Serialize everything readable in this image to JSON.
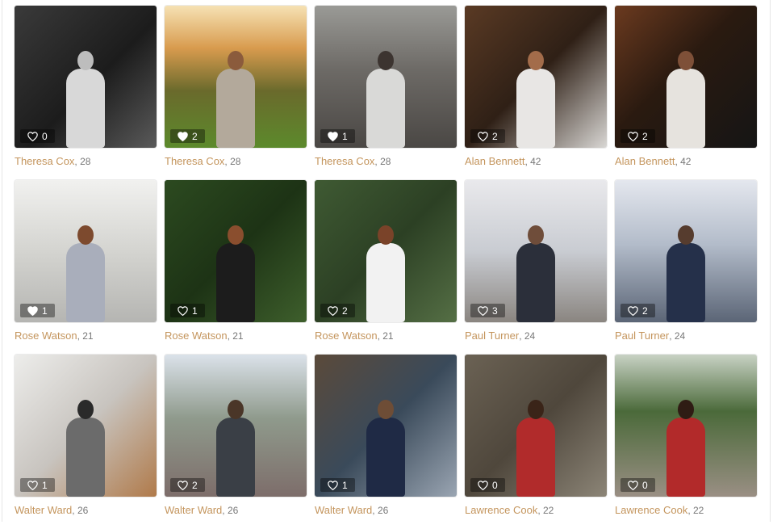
{
  "gallery": {
    "items": [
      {
        "name": "Theresa Cox",
        "age": "28",
        "likes": "0",
        "liked": false,
        "bg": "linear-gradient(135deg,#3a3a3a 0%,#1c1c1c 55%,#5a5a5a 100%)",
        "fig": "#d8d8d8",
        "head": "#bdbdbd"
      },
      {
        "name": "Theresa Cox",
        "age": "28",
        "likes": "2",
        "liked": true,
        "bg": "linear-gradient(180deg,#f6e2b4 0%,#d89b4e 30%,#6a6a2c 60%,#5c8a2c 100%)",
        "fig": "#b3a99b",
        "head": "#8b5b3c"
      },
      {
        "name": "Theresa Cox",
        "age": "28",
        "likes": "1",
        "liked": true,
        "bg": "linear-gradient(180deg,#9a9a96 0%,#6d6a66 45%,#4a4744 100%)",
        "fig": "#d9d9d7",
        "head": "#3c3430"
      },
      {
        "name": "Alan Bennett",
        "age": "42",
        "likes": "2",
        "liked": false,
        "bg": "linear-gradient(135deg,#5a3a24 0%,#2f2016 50%,#d9d7d4 100%)",
        "fig": "#e8e6e4",
        "head": "#a36c4a"
      },
      {
        "name": "Alan Bennett",
        "age": "42",
        "likes": "2",
        "liked": false,
        "bg": "linear-gradient(135deg,#6b3a1f 0%,#2a1a10 45%,#151515 100%)",
        "fig": "#e6e3de",
        "head": "#7e5038"
      },
      {
        "name": "Rose Watson",
        "age": "21",
        "likes": "1",
        "liked": true,
        "bg": "linear-gradient(180deg,#f1f1ef 0%,#d4d4d0 50%,#b5b5b2 100%)",
        "fig": "#a9aebb",
        "head": "#7d4a2e"
      },
      {
        "name": "Rose Watson",
        "age": "21",
        "likes": "1",
        "liked": false,
        "bg": "linear-gradient(135deg,#2c4a20 0%,#1d3315 50%,#3e5f2c 100%)",
        "fig": "#1c1c1c",
        "head": "#8a4e2e"
      },
      {
        "name": "Rose Watson",
        "age": "21",
        "likes": "2",
        "liked": false,
        "bg": "linear-gradient(135deg,#3f5a33 0%,#2c4024 50%,#556f45 100%)",
        "fig": "#f2f2f2",
        "head": "#7a4329"
      },
      {
        "name": "Paul Turner",
        "age": "24",
        "likes": "3",
        "liked": false,
        "bg": "linear-gradient(180deg,#e9e9ec 0%,#c9ccd2 50%,#8a8580 100%)",
        "fig": "#2b2f3a",
        "head": "#6f4d3a"
      },
      {
        "name": "Paul Turner",
        "age": "24",
        "likes": "2",
        "liked": false,
        "bg": "linear-gradient(180deg,#e4e7ee 0%,#b3bcca 45%,#5b6576 100%)",
        "fig": "#25304a",
        "head": "#563c2e"
      },
      {
        "name": "Walter Ward",
        "age": "26",
        "likes": "1",
        "liked": false,
        "bg": "linear-gradient(135deg,#ededeb 0%,#c8c4bf 50%,#b07a4a 100%)",
        "fig": "#6b6b6b",
        "head": "#2a2a2a"
      },
      {
        "name": "Walter Ward",
        "age": "26",
        "likes": "2",
        "liked": false,
        "bg": "linear-gradient(180deg,#dbe2ea 0%,#8f9a8c 45%,#7d6d6a 100%)",
        "fig": "#3a3f46",
        "head": "#4a3628"
      },
      {
        "name": "Walter Ward",
        "age": "26",
        "likes": "1",
        "liked": false,
        "bg": "linear-gradient(135deg,#5b4a3a 0%,#3a4a5a 50%,#9aa5b2 100%)",
        "fig": "#1f2a45",
        "head": "#6e4d36"
      },
      {
        "name": "Lawrence Cook",
        "age": "22",
        "likes": "0",
        "liked": false,
        "bg": "linear-gradient(135deg,#6b6254 0%,#4f473c 50%,#8c8577 100%)",
        "fig": "#b12b2b",
        "head": "#3a2418"
      },
      {
        "name": "Lawrence Cook",
        "age": "22",
        "likes": "0",
        "liked": false,
        "bg": "linear-gradient(180deg,#c8d2c4 0%,#4b6a3a 40%,#9a8f84 100%)",
        "fig": "#b22a2a",
        "head": "#2f1c14"
      }
    ]
  }
}
